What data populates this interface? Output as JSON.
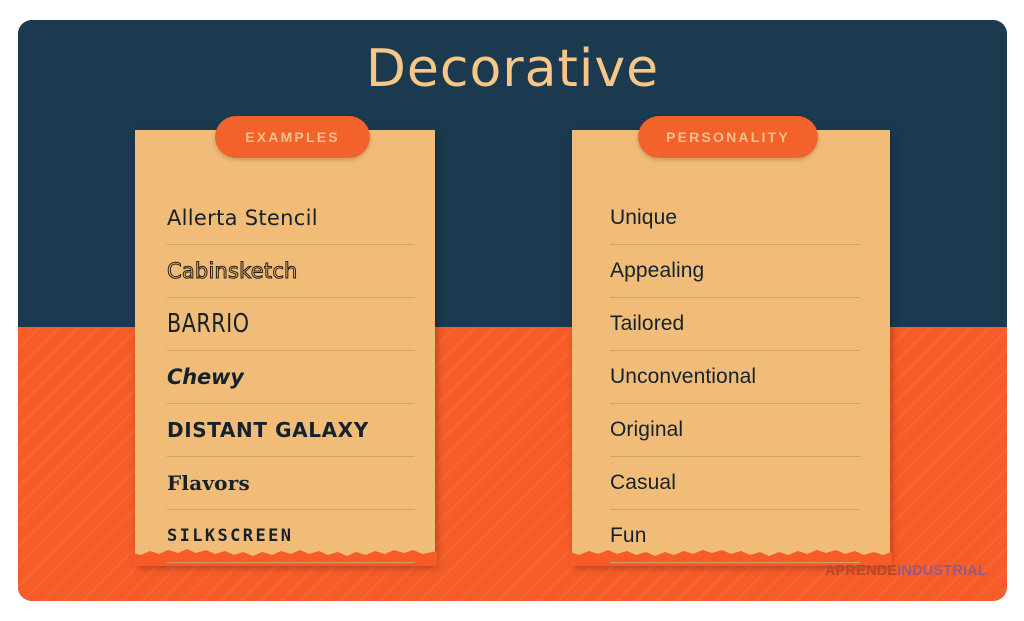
{
  "title": "Decorative",
  "colors": {
    "navy": "#1B3A4F",
    "orange": "#F75C28",
    "card_tan": "#F0BC78",
    "badge_orange": "#F4622C",
    "title_tan": "#F7C789",
    "divider": "#D2A169",
    "text_dark": "#15222B"
  },
  "examples": {
    "badge_label": "EXAMPLES",
    "items": [
      {
        "label": "Allerta Stencil"
      },
      {
        "label": "Cabinsketch"
      },
      {
        "label": "BARRIO"
      },
      {
        "label": "Chewy"
      },
      {
        "label": "DISTANT GALAXY"
      },
      {
        "label": "Flavors"
      },
      {
        "label": "SILKSCREEN"
      }
    ]
  },
  "personality": {
    "badge_label": "PERSONALITY",
    "items": [
      {
        "label": "Unique"
      },
      {
        "label": "Appealing"
      },
      {
        "label": "Tailored"
      },
      {
        "label": "Unconventional"
      },
      {
        "label": "Original"
      },
      {
        "label": "Casual"
      },
      {
        "label": "Fun"
      }
    ]
  },
  "watermark": {
    "part1": "APRENDE",
    "part2": "INDUSTRIAL"
  }
}
